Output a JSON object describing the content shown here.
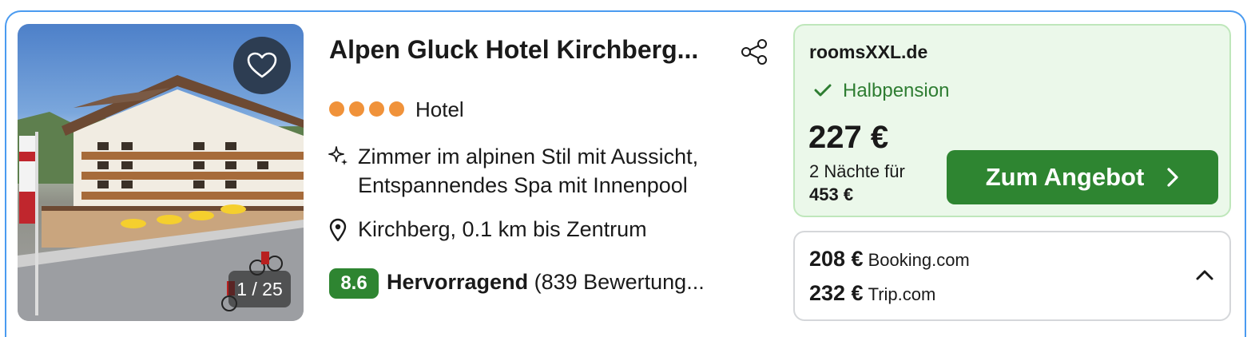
{
  "hotel": {
    "name": "Alpen Gluck Hotel Kirchberg...",
    "stars": 4,
    "type": "Hotel",
    "features": [
      "Zimmer im alpinen Stil mit Aussicht,",
      "Entspannendes Spa mit Innenpool"
    ],
    "location": "Kirchberg, 0.1 km bis Zentrum",
    "score": "8.6",
    "rating_label": "Hervorragend",
    "reviews": "(839 Bewertung..."
  },
  "image": {
    "counter": "1 / 25",
    "favorite_icon": "heart-outline-icon",
    "share_icon": "share-icon"
  },
  "offer": {
    "provider": "roomsXXL.de",
    "board": "Halbpension",
    "price": "227 €",
    "nights_label": "2 Nächte für",
    "total": "453 €",
    "cta_label": "Zum Angebot",
    "cta_icon": "chevron-right-icon"
  },
  "other_offers": [
    {
      "price": "208 €",
      "provider": "Booking.com"
    },
    {
      "price": "232 €",
      "provider": "Trip.com"
    }
  ],
  "colors": {
    "accent_green": "#2e8531",
    "star_orange": "#f0923a",
    "offer_bg": "#ebf8ea",
    "card_border": "#4a9bf0"
  }
}
